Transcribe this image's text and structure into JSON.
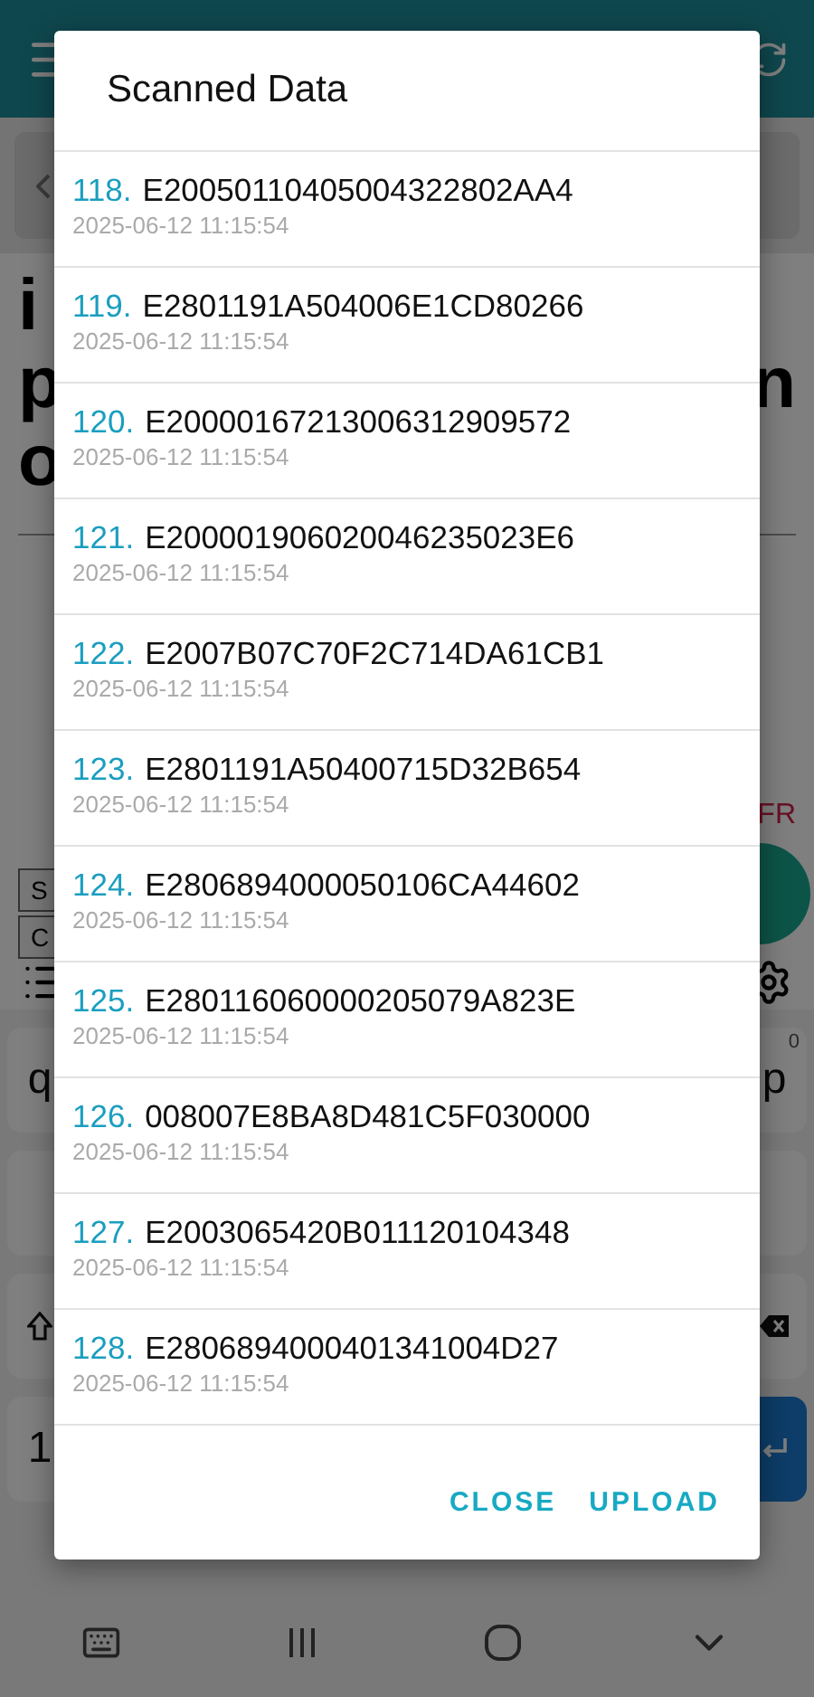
{
  "background": {
    "heading_rows": [
      {
        "left": "i"
      },
      {
        "left": "p",
        "right": "n"
      },
      {
        "left": "o"
      }
    ],
    "status_text": "FR",
    "side_buttons": [
      "S",
      "C"
    ],
    "keyboard": {
      "rows": [
        {
          "keys": [
            {
              "kind": "letter",
              "label": "q"
            },
            {
              "kind": "letter",
              "label": "p",
              "hint": "0"
            }
          ]
        },
        {
          "keys": [
            {
              "kind": "blank"
            },
            {
              "kind": "blank"
            }
          ]
        },
        {
          "keys": [
            {
              "kind": "shift"
            },
            {
              "kind": "backspace"
            }
          ]
        },
        {
          "keys": [
            {
              "kind": "letter",
              "label": "1"
            },
            {
              "kind": "enter"
            }
          ]
        }
      ]
    }
  },
  "dialog": {
    "title": "Scanned Data",
    "items": [
      {
        "number": "118.",
        "code": "E20050110405004322802AA4",
        "time": "2025-06-12 11:15:54"
      },
      {
        "number": "119.",
        "code": "E2801191A504006E1CD80266",
        "time": "2025-06-12 11:15:54"
      },
      {
        "number": "120.",
        "code": "E20000167213006312909572",
        "time": "2025-06-12 11:15:54"
      },
      {
        "number": "121.",
        "code": "E200001906020046235023E6",
        "time": "2025-06-12 11:15:54"
      },
      {
        "number": "122.",
        "code": "E2007B07C70F2C714DA61CB1",
        "time": "2025-06-12 11:15:54"
      },
      {
        "number": "123.",
        "code": "E2801191A50400715D32B654",
        "time": "2025-06-12 11:15:54"
      },
      {
        "number": "124.",
        "code": "E2806894000050106CA44602",
        "time": "2025-06-12 11:15:54"
      },
      {
        "number": "125.",
        "code": "E280116060000205079A823E",
        "time": "2025-06-12 11:15:54"
      },
      {
        "number": "126.",
        "code": "008007E8BA8D481C5F030000",
        "time": "2025-06-12 11:15:54"
      },
      {
        "number": "127.",
        "code": "E2003065420B011120104348",
        "time": "2025-06-12 11:15:54"
      },
      {
        "number": "128.",
        "code": "E2806894000401341004D27",
        "time": "2025-06-12 11:15:54"
      }
    ],
    "buttons": [
      "CLOSE",
      "UPLOAD"
    ]
  }
}
